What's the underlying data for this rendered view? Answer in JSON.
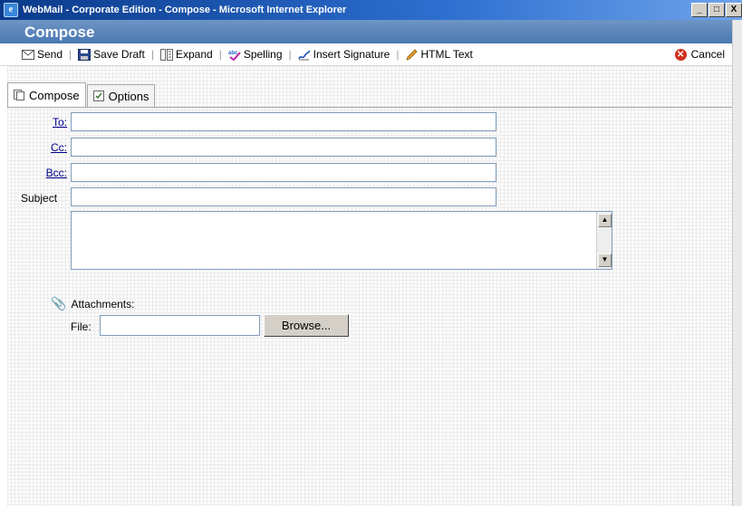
{
  "window": {
    "title": "WebMail - Corporate Edition - Compose - Microsoft Internet Explorer",
    "minimize": "_",
    "maximize": "□",
    "close": "X"
  },
  "header": {
    "title": "Compose"
  },
  "toolbar": {
    "send": "Send",
    "save_draft": "Save Draft",
    "expand": "Expand",
    "spelling": "Spelling",
    "insert_signature": "Insert Signature",
    "html_text": "HTML Text",
    "cancel": "Cancel"
  },
  "tabs": [
    {
      "label": "Compose",
      "active": true
    },
    {
      "label": "Options",
      "active": false
    }
  ],
  "form": {
    "to_label": "To:",
    "cc_label": "Cc:",
    "bcc_label": "Bcc:",
    "subject_label": "Subject",
    "to_value": "",
    "cc_value": "",
    "bcc_value": "",
    "subject_value": "",
    "body_value": ""
  },
  "attachments": {
    "label": "Attachments:",
    "file_label": "File:",
    "browse": "Browse..."
  },
  "colors": {
    "title_bar": "#0a3a8a",
    "header": "#5b86bd",
    "link": "#00008b",
    "cancel": "#d03020"
  }
}
